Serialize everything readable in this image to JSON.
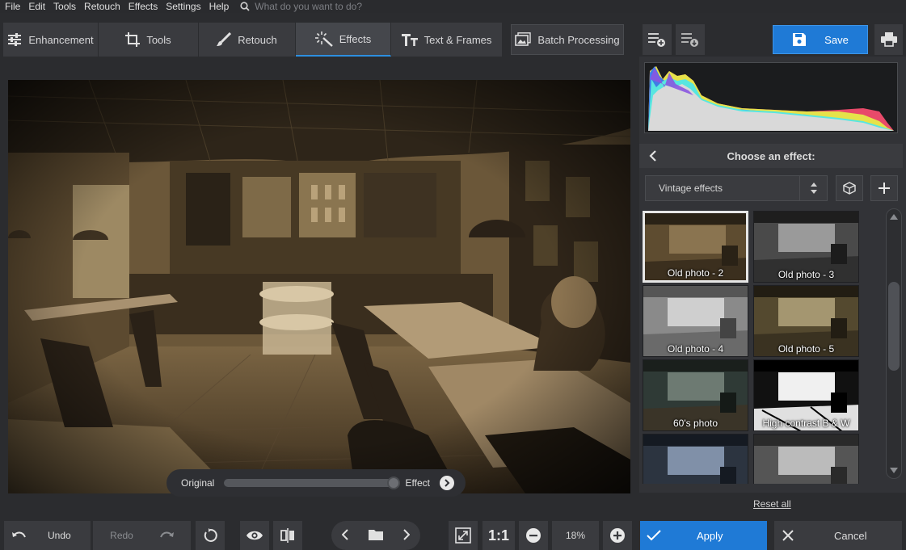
{
  "menu": {
    "items": [
      "File",
      "Edit",
      "Tools",
      "Retouch",
      "Effects",
      "Settings",
      "Help"
    ],
    "search_placeholder": "What do you want to do?"
  },
  "tabs": [
    {
      "label": "Enhancement",
      "icon": "sliders-icon"
    },
    {
      "label": "Tools",
      "icon": "crop-icon"
    },
    {
      "label": "Retouch",
      "icon": "brush-icon"
    },
    {
      "label": "Effects",
      "icon": "magic-wand-icon",
      "active": true
    },
    {
      "label": "Text & Frames",
      "icon": "text-icon"
    }
  ],
  "toolbar": {
    "batch_label": "Batch Processing",
    "save_label": "Save"
  },
  "compare": {
    "original_label": "Original",
    "effect_label": "Effect",
    "position": 1.0
  },
  "panel": {
    "header_title": "Choose an effect:",
    "category": "Vintage effects",
    "thumbnails": [
      {
        "label": "Old photo - 2",
        "selected": true,
        "tone": "sepia"
      },
      {
        "label": "Old photo - 3",
        "tone": "gray"
      },
      {
        "label": "Old photo - 4",
        "tone": "light-gray"
      },
      {
        "label": "Old photo - 5",
        "tone": "olive"
      },
      {
        "label": "60's photo",
        "tone": "teal"
      },
      {
        "label": "High contrast B & W",
        "tone": "bw"
      },
      {
        "label": "",
        "tone": "cold"
      },
      {
        "label": "",
        "tone": "gray"
      }
    ],
    "reset_label": "Reset all"
  },
  "bottom": {
    "undo_label": "Undo",
    "redo_label": "Redo",
    "zoom_ratio_label": "1:1",
    "zoom_value": "18%",
    "apply_label": "Apply",
    "cancel_label": "Cancel"
  },
  "colors": {
    "accent": "#1f7ad6",
    "bg": "#2b2c2f",
    "panel": "#3a3b3f"
  }
}
